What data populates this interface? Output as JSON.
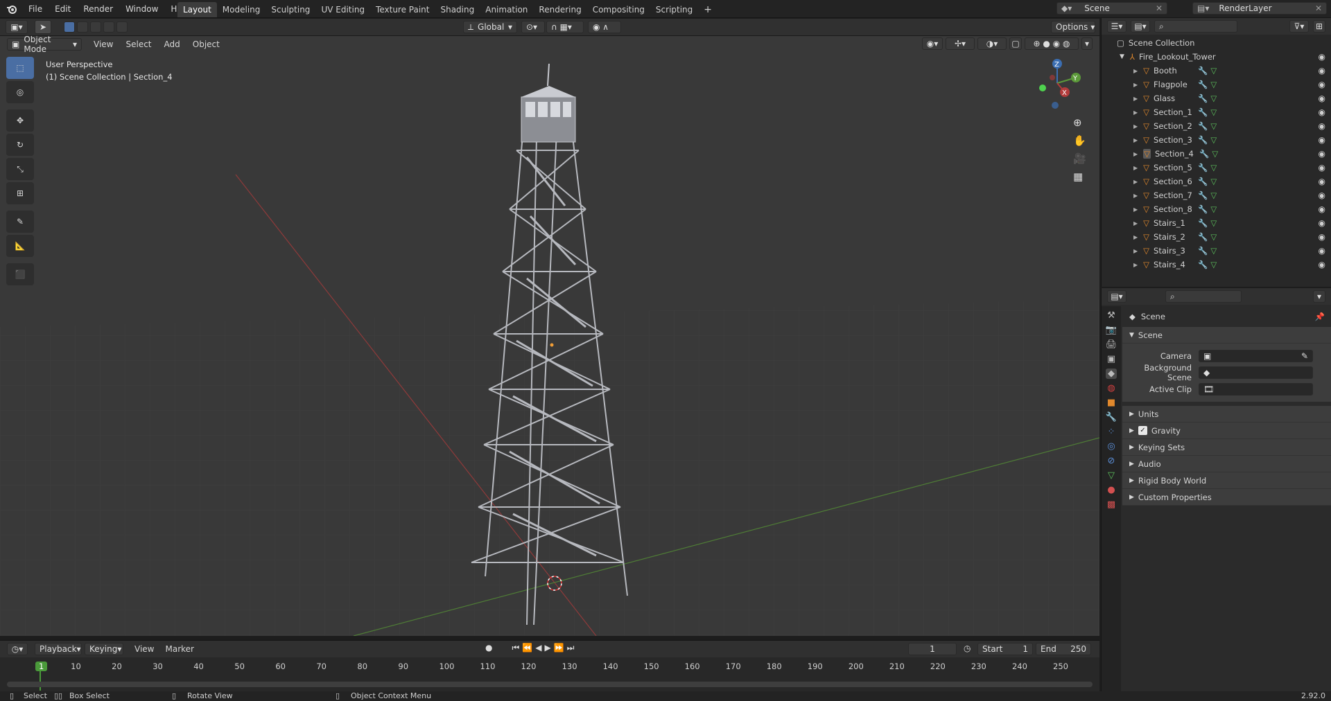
{
  "app": {
    "menu": [
      "File",
      "Edit",
      "Render",
      "Window",
      "Help"
    ],
    "workspaces": [
      "Layout",
      "Modeling",
      "Sculpting",
      "UV Editing",
      "Texture Paint",
      "Shading",
      "Animation",
      "Rendering",
      "Compositing",
      "Scripting"
    ],
    "active_workspace": "Layout",
    "scene_name": "Scene",
    "view_layer": "RenderLayer"
  },
  "viewport": {
    "mode": "Object Mode",
    "menus": [
      "View",
      "Select",
      "Add",
      "Object"
    ],
    "transform": "Global",
    "options": "Options",
    "overlay_title": "User Perspective",
    "overlay_sub": "(1) Scene Collection | Section_4",
    "gizmo": {
      "z": "Z",
      "y": "Y",
      "x": "X"
    }
  },
  "outliner": {
    "root": "Scene Collection",
    "collection": "Fire_Lookout_Tower",
    "items": [
      "Booth",
      "Flagpole",
      "Glass",
      "Section_1",
      "Section_2",
      "Section_3",
      "Section_4",
      "Section_5",
      "Section_6",
      "Section_7",
      "Section_8",
      "Stairs_1",
      "Stairs_2",
      "Stairs_3",
      "Stairs_4"
    ],
    "selected": "Section_4"
  },
  "properties": {
    "context": "Scene",
    "panel": "Scene",
    "fields": [
      {
        "label": "Camera",
        "value": ""
      },
      {
        "label": "Background Scene",
        "value": ""
      },
      {
        "label": "Active Clip",
        "value": ""
      }
    ],
    "subpanels": [
      "Units",
      "Gravity",
      "Keying Sets",
      "Audio",
      "Rigid Body World",
      "Custom Properties"
    ],
    "gravity_checked": true
  },
  "timeline": {
    "menus": [
      "Playback",
      "Keying",
      "View",
      "Marker"
    ],
    "current_frame": "1",
    "start_label": "Start",
    "start": "1",
    "end_label": "End",
    "end": "250",
    "ticks": [
      "1",
      "10",
      "20",
      "30",
      "40",
      "50",
      "60",
      "70",
      "80",
      "90",
      "100",
      "110",
      "120",
      "130",
      "140",
      "150",
      "160",
      "170",
      "180",
      "190",
      "200",
      "210",
      "220",
      "230",
      "240",
      "250"
    ]
  },
  "status": {
    "select": "Select",
    "box_select": "Box Select",
    "rotate": "Rotate View",
    "context_menu": "Object Context Menu",
    "version": "2.92.0"
  },
  "colors": {
    "accent": "#4a6ea3",
    "object_orange": "#e0882c",
    "x_axis": "#b23b3b",
    "y_axis": "#5c9a3a",
    "z_axis": "#3b6eb2"
  }
}
